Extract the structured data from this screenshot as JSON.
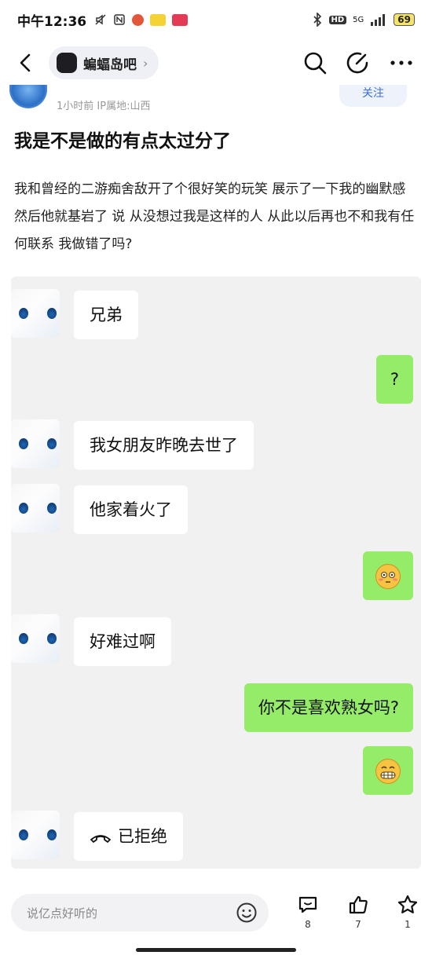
{
  "status_bar": {
    "time": "中午12:36",
    "network": "5G",
    "battery": "69"
  },
  "nav": {
    "forum_name": "蝙蝠岛吧",
    "icons": [
      "back-icon",
      "search-icon",
      "edit-icon",
      "more-icon"
    ]
  },
  "post": {
    "meta": "1小时前   IP属地:山西",
    "follow_label": "关注",
    "title": "我是不是做的有点太过分了",
    "body": "我和曾经的二游痴舍敌开了个很好笑的玩笑 展示了一下我的幽默感 然后他就基岩了 说 从没想过我是这样的人 从此以后再也不和我有任何联系 我做错了吗?"
  },
  "chat": {
    "messages": [
      {
        "side": "left",
        "text": "兄弟"
      },
      {
        "side": "right",
        "text": "?"
      },
      {
        "side": "left",
        "text": "我女朋友昨晚去世了"
      },
      {
        "side": "left",
        "text": "他家着火了"
      },
      {
        "side": "right",
        "emoji": "flushed-emoji"
      },
      {
        "side": "left",
        "text": "好难过啊"
      },
      {
        "side": "right",
        "text": "你不是喜欢熟女吗?"
      },
      {
        "side": "right",
        "emoji": "grimacing-emoji"
      },
      {
        "side": "left",
        "text": "已拒绝",
        "icon": "declined-call-icon"
      }
    ],
    "colors": {
      "right_bubble": "#95ec69",
      "left_bubble": "#ffffff",
      "background": "#f1f1f1"
    }
  },
  "bottom_bar": {
    "comment_placeholder": "说亿点好听的",
    "comment_count": "8",
    "like_count": "7",
    "favorite_count": "1"
  }
}
